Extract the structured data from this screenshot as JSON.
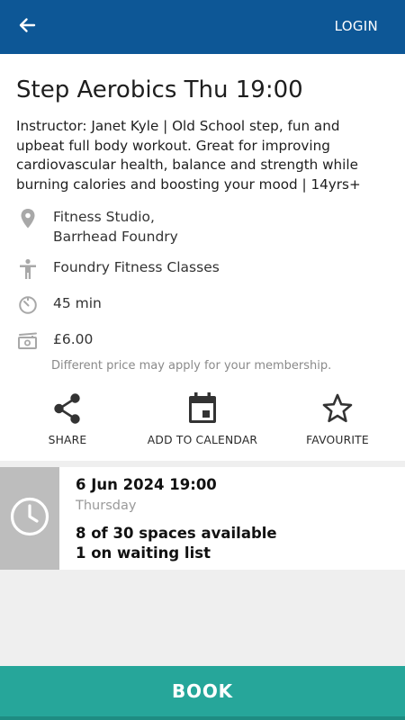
{
  "appbar": {
    "back_icon": "arrow-left-icon",
    "login_label": "LOGIN",
    "color": "#0d5796"
  },
  "class": {
    "title": "Step Aerobics Thu 19:00",
    "description": "Instructor: Janet Kyle | Old School step, fun and upbeat full body workout. Great for improving cardiovascular health, balance and strength while burning calories and boosting your mood | 14yrs+",
    "location_line1": "Fitness Studio,",
    "location_line2": "Barrhead Foundry",
    "category": "Foundry Fitness Classes",
    "duration": "45 min",
    "price": "£6.00",
    "membership_note": "Different price may apply for your membership.",
    "icons": {
      "location": "location-pin-icon",
      "category": "person-icon",
      "duration": "timer-icon",
      "price": "banknote-icon"
    }
  },
  "actions": {
    "share_label": "SHARE",
    "calendar_label": "ADD TO CALENDAR",
    "favourite_label": "FAVOURITE"
  },
  "session": {
    "datetime": "6 Jun 2024 19:00",
    "day": "Thursday",
    "spaces": "8 of 30 spaces available",
    "waiting": "1 on waiting list",
    "icon": "clock-icon"
  },
  "book": {
    "label": "BOOK",
    "color": "#26a69a"
  }
}
